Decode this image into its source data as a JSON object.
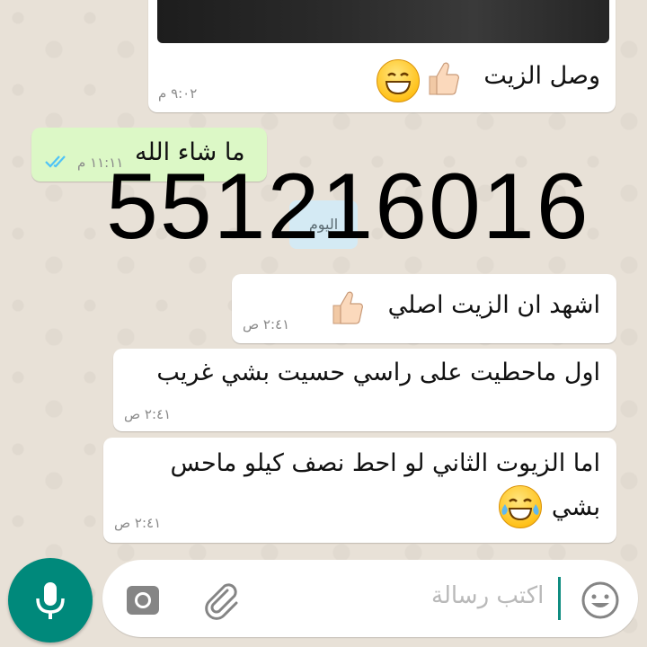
{
  "messages": [
    {
      "id": "m1",
      "direction": "incoming",
      "text": "وصل الزيت",
      "time": "٩:٠٢ م",
      "emoji": [
        "laughing-face",
        "thumbs-up"
      ]
    },
    {
      "id": "m2",
      "direction": "outgoing",
      "text": "ما شاء الله",
      "time": "١١:١١ م",
      "status": "read"
    },
    {
      "id": "m3",
      "direction": "incoming",
      "text": "اشهد ان الزيت اصلي",
      "time": "٢:٤١ ص",
      "emoji": [
        "thumbs-up"
      ]
    },
    {
      "id": "m4",
      "direction": "incoming",
      "text": "اول ماحطيت على راسي حسيت بشي غريب",
      "time": "٢:٤١ ص"
    },
    {
      "id": "m5",
      "direction": "incoming",
      "lines": [
        "اما الزيوت الثاني لو احط نصف كيلو ماحس",
        "بشي"
      ],
      "time": "٢:٤١ ص",
      "emoji": [
        "tears-of-joy"
      ]
    }
  ],
  "date_divider": "اليوم",
  "overlay_number": "551216016",
  "composer": {
    "placeholder": "اكتب رسالة"
  },
  "colors": {
    "outgoing_bubble": "#dcf8c6",
    "incoming_bubble": "#ffffff",
    "accent": "#00897b",
    "read_ticks": "#4fc3f7"
  },
  "icons": [
    "emoji-icon",
    "attach-icon",
    "camera-icon",
    "mic-icon",
    "read-ticks-icon"
  ]
}
